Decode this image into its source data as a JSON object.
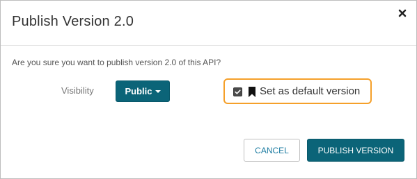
{
  "dialog": {
    "title": "Publish Version 2.0",
    "close_icon": "close-icon",
    "message": "Are you sure you want to publish version 2.0 of this API?",
    "visibility_label": "Visibility",
    "visibility_value": "Public",
    "default_version_label": "Set as default version",
    "default_version_checked": true,
    "cancel_label": "CANCEL",
    "publish_label": "PUBLISH VERSION"
  },
  "colors": {
    "primary": "#0b6478",
    "highlight": "#f5a02a",
    "link": "#1a7aa0"
  }
}
